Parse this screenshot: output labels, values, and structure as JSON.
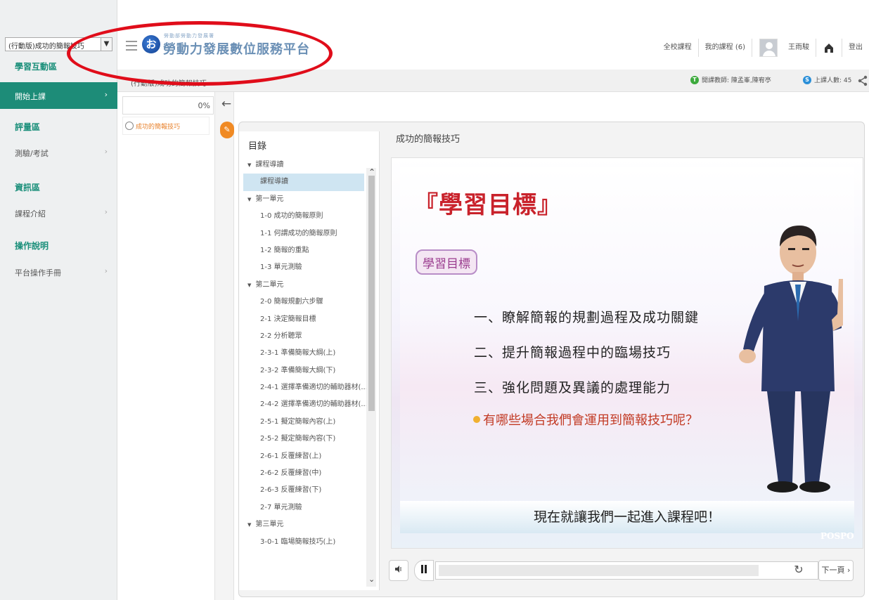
{
  "header": {
    "course_select_value": "(行動版)成功的簡報技巧",
    "logo_glyph": "お",
    "logo_subtitle": "勞動部勞動力發展署",
    "platform_title": "勞動力發展數位服務平台",
    "nav": {
      "all_courses": "全校課程",
      "my_courses": "我的課程 (6)",
      "user_name": "王雨駿",
      "logout": "登出"
    }
  },
  "sidebar": {
    "groups": [
      {
        "title": "學習互動區",
        "items": [
          {
            "label": "開始上課",
            "active": true
          },
          {
            "label": "評量區",
            "is_group": true
          },
          {
            "label": "測驗/考試"
          }
        ]
      }
    ],
    "group1": "學習互動區",
    "item_start": "開始上課",
    "group2": "評量區",
    "item_quiz": "測驗/考試",
    "group3": "資訊區",
    "item_intro": "課程介紹",
    "group4": "操作說明",
    "item_manual": "平台操作手冊"
  },
  "subbar": {
    "course_title": "(行動版)成功的簡報技巧",
    "teacher_label": "開課教師: 陳孟峯,陳宥亭",
    "online_label": "上課人數: 45"
  },
  "progress": {
    "percent": "0%",
    "item_label": "成功的簡報技巧"
  },
  "toc": {
    "tab_label": "目錄",
    "rows": [
      {
        "label": "課程導讀",
        "type": "group"
      },
      {
        "label": "課程導讀",
        "type": "leaf",
        "selected": true
      },
      {
        "label": "第一單元",
        "type": "group"
      },
      {
        "label": "1-0 成功的簡報原則",
        "type": "leaf"
      },
      {
        "label": "1-1 何謂成功的簡報原則",
        "type": "leaf"
      },
      {
        "label": "1-2 簡報的重點",
        "type": "leaf"
      },
      {
        "label": "1-3 單元測驗",
        "type": "leaf"
      },
      {
        "label": "第二單元",
        "type": "group"
      },
      {
        "label": "2-0 簡報規劃六步驟",
        "type": "leaf"
      },
      {
        "label": "2-1 決定簡報目標",
        "type": "leaf"
      },
      {
        "label": "2-2 分析聽眾",
        "type": "leaf"
      },
      {
        "label": "2-3-1 準備簡報大綱(上)",
        "type": "leaf"
      },
      {
        "label": "2-3-2 準備簡報大綱(下)",
        "type": "leaf"
      },
      {
        "label": "2-4-1 選擇準備適切的輔助器材(...",
        "type": "leaf"
      },
      {
        "label": "2-4-2 選擇準備適切的輔助器材(...",
        "type": "leaf"
      },
      {
        "label": "2-5-1 擬定簡報內容(上)",
        "type": "leaf"
      },
      {
        "label": "2-5-2 擬定簡報內容(下)",
        "type": "leaf"
      },
      {
        "label": "2-6-1 反覆練習(上)",
        "type": "leaf"
      },
      {
        "label": "2-6-2 反覆練習(中)",
        "type": "leaf"
      },
      {
        "label": "2-6-3 反覆練習(下)",
        "type": "leaf"
      },
      {
        "label": "2-7 單元測驗",
        "type": "leaf"
      },
      {
        "label": "第三單元",
        "type": "group"
      },
      {
        "label": "3-0-1 臨場簡報技巧(上)",
        "type": "leaf"
      }
    ]
  },
  "lesson": {
    "title": "成功的簡報技巧"
  },
  "slide": {
    "heading": "『學習目標』",
    "badge": "學習目標",
    "point1": "一、瞭解簡報的規劃過程及成功關鍵",
    "point2": "二、提升簡報過程中的臨場技巧",
    "point3": "三、強化問題及異議的處理能力",
    "question": "有哪些場合我們會運用到簡報技巧呢？",
    "footer": "現在就讓我們一起進入課程吧！",
    "watermark": "POSPO"
  },
  "controls": {
    "next_label": "下一頁 ›",
    "seek_progress": 0.85
  },
  "colors": {
    "accent_green": "#1d8c78",
    "annotation_red": "#e00d1a",
    "slide_heading_red": "#c9222b"
  }
}
